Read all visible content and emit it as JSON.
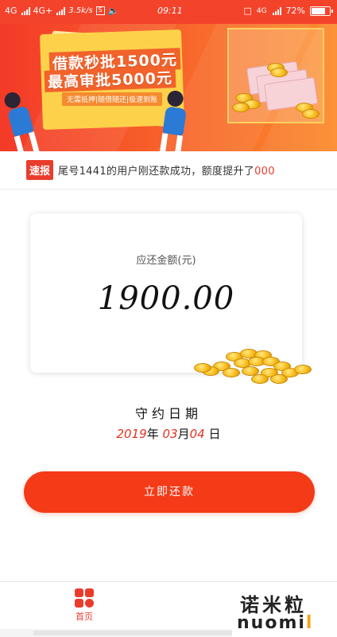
{
  "status_bar": {
    "network1": "4G",
    "network2": "4G+",
    "speed": "3.5k/s",
    "box_glyph": "S",
    "time": "09:11",
    "network_right": "4G",
    "battery": "72%"
  },
  "banner": {
    "headline1": "借款秒批1500元",
    "headline2": "最高审批5000元",
    "subtext": "无需抵押|随借随还|极速到账"
  },
  "ticker": {
    "badge": "速报",
    "text": "尾号1441的用户刚还款成功，额度提升了",
    "highlight": "000"
  },
  "amount_card": {
    "label": "应还金额(元)",
    "amount": "1900.00"
  },
  "due": {
    "label": "守约日期",
    "year": "2019",
    "year_char": "年",
    "month": "03",
    "month_char": "月",
    "day": "04",
    "day_char": "日"
  },
  "repay_button": {
    "label": "立即还款"
  },
  "bottom_nav": {
    "home_label": "首页",
    "home_icon": "home-grid-icon"
  },
  "watermark": {
    "chinese": "诺米粒",
    "english_prefix": "nuomi",
    "english_suffix": "l"
  },
  "colors": {
    "accent": "#f43a17",
    "badge": "#ea3c2c",
    "banner_start": "#f43a28",
    "banner_end": "#fb8a2a"
  }
}
